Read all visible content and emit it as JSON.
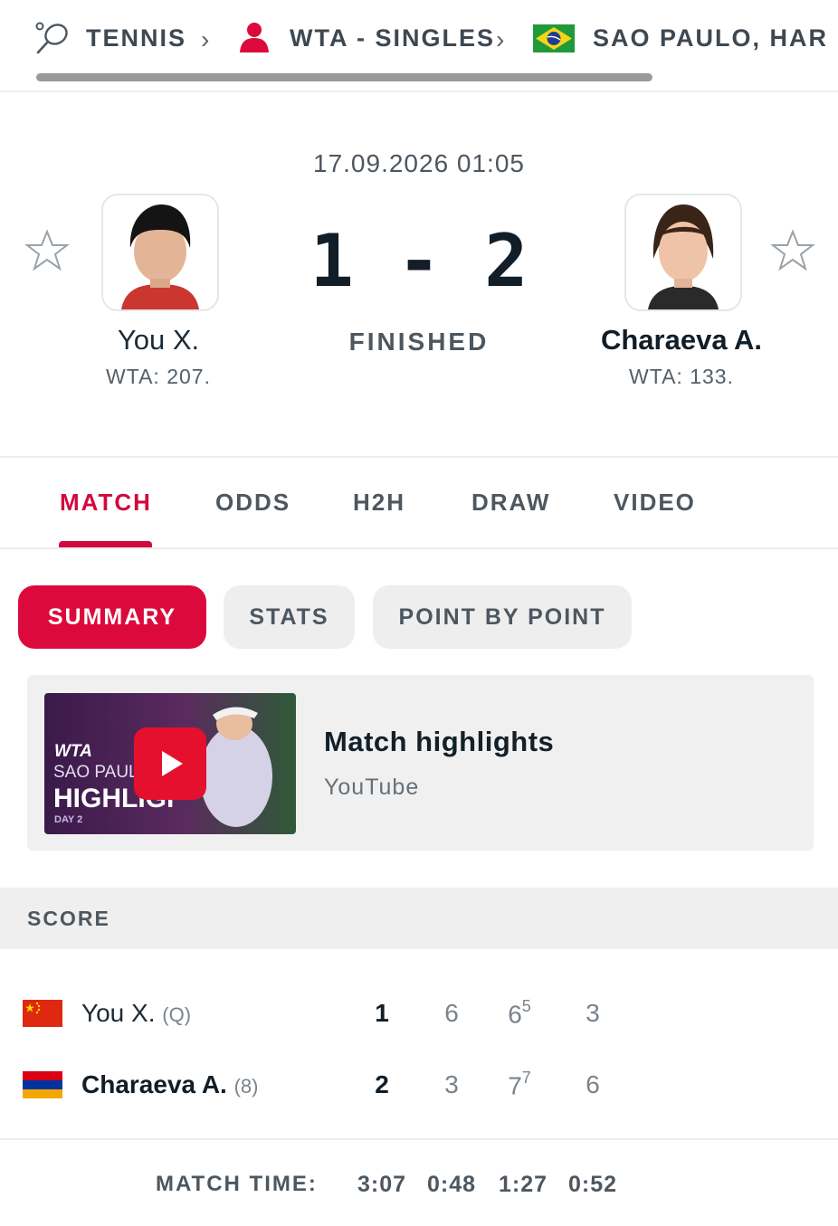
{
  "breadcrumb": {
    "sport": "TENNIS",
    "category": "WTA - SINGLES",
    "tournament": "SAO PAULO, HAR",
    "icons": [
      "tennis-racket-icon",
      "chevron-right-icon",
      "wta-player-icon",
      "chevron-right-icon",
      "brazil-flag-icon"
    ]
  },
  "match": {
    "datetime": "17.09.2026 01:05",
    "score": "1 - 2",
    "status": "FINISHED",
    "home": {
      "name": "You X.",
      "rank": "WTA: 207."
    },
    "away": {
      "name": "Charaeva A.",
      "rank": "WTA: 133."
    }
  },
  "tabs": [
    "MATCH",
    "ODDS",
    "H2H",
    "DRAW",
    "VIDEO"
  ],
  "active_tab": "MATCH",
  "subtabs": [
    "SUMMARY",
    "STATS",
    "POINT BY POINT"
  ],
  "active_subtab": "SUMMARY",
  "highlights": {
    "title": "Match highlights",
    "source": "YouTube",
    "thumb_text": {
      "line1": "WTA",
      "line2": "SAO PAULO",
      "line3": "HIGHLIGHTS",
      "line4": "DAY 2"
    }
  },
  "score_section": {
    "title": "SCORE",
    "rows": [
      {
        "name": "You X.",
        "seed": "(Q)",
        "flag": "china-flag",
        "total": "1",
        "sets": [
          {
            "v": "6",
            "tb": ""
          },
          {
            "v": "6",
            "tb": "5"
          },
          {
            "v": "3",
            "tb": ""
          }
        ]
      },
      {
        "name": "Charaeva A.",
        "seed": "(8)",
        "flag": "armenia-flag",
        "total": "2",
        "sets": [
          {
            "v": "3",
            "tb": ""
          },
          {
            "v": "7",
            "tb": "7"
          },
          {
            "v": "6",
            "tb": ""
          }
        ]
      }
    ],
    "match_time_label": "MATCH TIME:",
    "match_time": [
      "3:07",
      "0:48",
      "1:27",
      "0:52"
    ]
  },
  "colors": {
    "accent": "#dc0a3c",
    "text": "#1c2b36",
    "muted": "#4d5760"
  }
}
